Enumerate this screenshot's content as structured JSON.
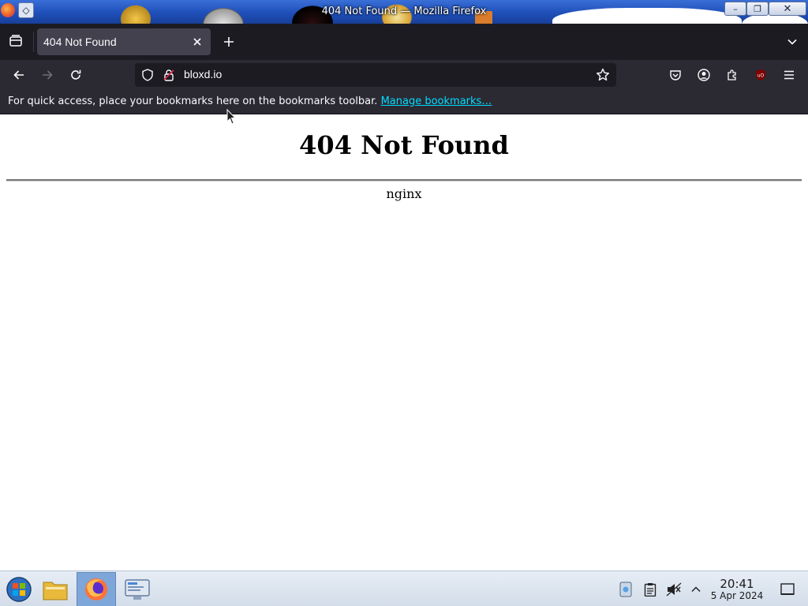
{
  "window": {
    "title": "404 Not Found — Mozilla Firefox",
    "buttons": {
      "minimize": "–",
      "maximize": "❐",
      "close": "✕"
    }
  },
  "tabs": [
    {
      "title": "404 Not Found",
      "active": true
    }
  ],
  "navbar": {
    "url": "bloxd.io",
    "icons": [
      "arrow-left-icon",
      "arrow-right-icon",
      "reload-icon",
      "shield-icon",
      "lock-icon",
      "star-icon",
      "pocket-icon",
      "account-icon",
      "extensions-icon",
      "ublock-icon",
      "hamburger-menu-icon"
    ]
  },
  "bookmarks_bar": {
    "message": "For quick access, place your bookmarks here on the bookmarks toolbar.",
    "link": "Manage bookmarks…"
  },
  "page": {
    "heading": "404 Not Found",
    "server": "nginx"
  },
  "taskbar": {
    "items": [
      "start-menu",
      "file-manager",
      "firefox",
      "remote-desktop"
    ],
    "clock": {
      "time": "20:41",
      "date": "5 Apr 2024"
    }
  },
  "colors": {
    "tab_strip": "#1c1b22",
    "toolbar": "#2b2a33",
    "active_tab": "#42414d",
    "link": "#00ddff"
  }
}
